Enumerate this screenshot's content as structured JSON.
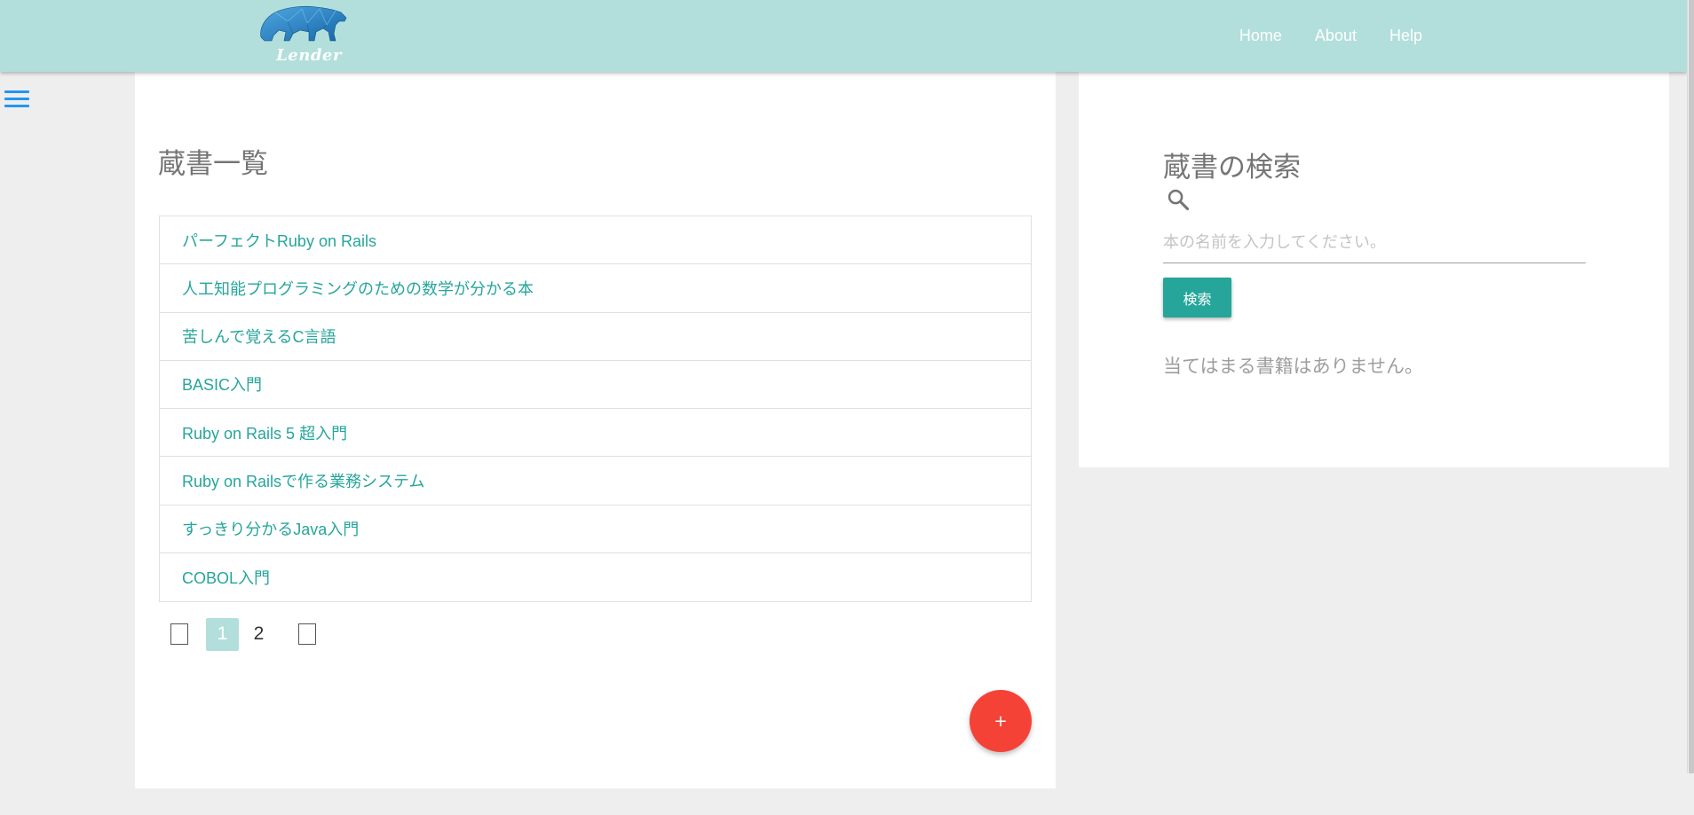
{
  "navbar": {
    "logo_text": "Lender",
    "links": [
      "Home",
      "About",
      "Help"
    ]
  },
  "main": {
    "title": "蔵書一覧",
    "books": [
      "パーフェクトRuby on Rails",
      "人工知能プログラミングのための数学が分かる本",
      "苦しんで覚えるC言語",
      "BASIC入門",
      "Ruby on Rails 5 超入門",
      "Ruby on Railsで作る業務システム",
      "すっきり分かるJava入門",
      "COBOL入門"
    ],
    "pagination": {
      "pages": [
        "1",
        "2"
      ],
      "current": "1"
    },
    "fab_label": "+"
  },
  "search": {
    "title": "蔵書の検索",
    "placeholder": "本の名前を入力してください。",
    "value": "",
    "button_label": "検索",
    "no_result_text": "当てはまる書籍はありません。"
  },
  "colors": {
    "navbar": "#b2dfdb",
    "accent": "#26a69a",
    "fab": "#f44336",
    "hamburger": "#2196f3"
  }
}
